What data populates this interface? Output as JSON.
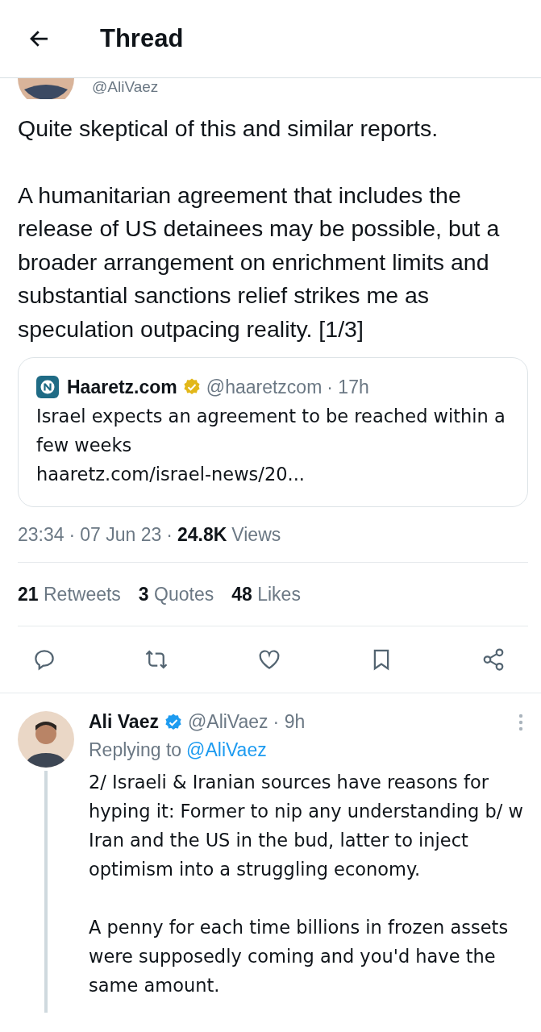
{
  "header": {
    "title": "Thread"
  },
  "main_tweet": {
    "handle": "@AliVaez",
    "paragraphs": [
      "Quite skeptical of this and similar reports.",
      "A humanitarian agreement that includes the release of US detainees may be possible, but a broader arrangement on enrichment limits and substantial sanctions relief strikes me as speculation outpacing reality. [1/3]"
    ],
    "quote": {
      "name": "Haaretz.com",
      "verified": true,
      "handle": "@haaretzcom",
      "time": "· 17h",
      "text": "Israel expects an agreement to be reached within a few weeks",
      "link": "haaretz.com/israel-news/20..."
    },
    "meta": [
      {
        "kind": "time",
        "text": "23:34"
      },
      {
        "kind": "separator",
        "text": "·"
      },
      {
        "kind": "date",
        "text": "07 Jun 23"
      },
      {
        "kind": "separator",
        "text": "·"
      },
      {
        "kind": "views_count",
        "text": "24.8K"
      },
      {
        "kind": "views_label",
        "text": "Views"
      }
    ],
    "stats": [
      {
        "count": "21",
        "label": "Retweets"
      },
      {
        "count": "3",
        "label": "Quotes"
      },
      {
        "count": "48",
        "label": "Likes"
      }
    ],
    "actions": [
      {
        "kind": "reply"
      },
      {
        "kind": "retweet"
      },
      {
        "kind": "like"
      },
      {
        "kind": "bookmark"
      },
      {
        "kind": "share"
      }
    ]
  },
  "reply": {
    "name": "Ali Vaez",
    "verified": true,
    "handle": "@AliVaez",
    "time": "· 9h",
    "replying_label": "Replying to",
    "replying_handle": "@AliVaez",
    "paragraphs": [
      "2/ Israeli & Iranian sources have reasons for hyping it: Former to nip any understanding b/ w Iran and the US in the bud, latter to inject optimism into a struggling economy.",
      "A penny for each time billions in frozen assets were supposedly coming and you'd have the same amount."
    ]
  }
}
